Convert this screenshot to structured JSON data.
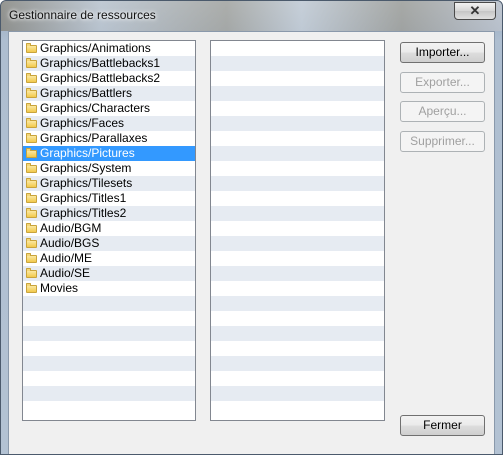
{
  "window": {
    "title": "Gestionnaire de ressources",
    "close_glyph": "✕"
  },
  "folders": [
    {
      "label": "Graphics/Animations",
      "selected": false
    },
    {
      "label": "Graphics/Battlebacks1",
      "selected": false
    },
    {
      "label": "Graphics/Battlebacks2",
      "selected": false
    },
    {
      "label": "Graphics/Battlers",
      "selected": false
    },
    {
      "label": "Graphics/Characters",
      "selected": false
    },
    {
      "label": "Graphics/Faces",
      "selected": false
    },
    {
      "label": "Graphics/Parallaxes",
      "selected": false
    },
    {
      "label": "Graphics/Pictures",
      "selected": true
    },
    {
      "label": "Graphics/System",
      "selected": false
    },
    {
      "label": "Graphics/Tilesets",
      "selected": false
    },
    {
      "label": "Graphics/Titles1",
      "selected": false
    },
    {
      "label": "Graphics/Titles2",
      "selected": false
    },
    {
      "label": "Audio/BGM",
      "selected": false
    },
    {
      "label": "Audio/BGS",
      "selected": false
    },
    {
      "label": "Audio/ME",
      "selected": false
    },
    {
      "label": "Audio/SE",
      "selected": false
    },
    {
      "label": "Movies",
      "selected": false
    }
  ],
  "files": [],
  "buttons": {
    "import": {
      "label": "Importer...",
      "enabled": true
    },
    "export": {
      "label": "Exporter...",
      "enabled": false
    },
    "preview": {
      "label": "Aperçu...",
      "enabled": false
    },
    "delete": {
      "label": "Supprimer...",
      "enabled": false
    },
    "close": {
      "label": "Fermer",
      "enabled": true
    }
  },
  "colors": {
    "selection": "#3399ff",
    "stripe": "#e6ebf2",
    "folder_icon": "#f2c94c"
  }
}
